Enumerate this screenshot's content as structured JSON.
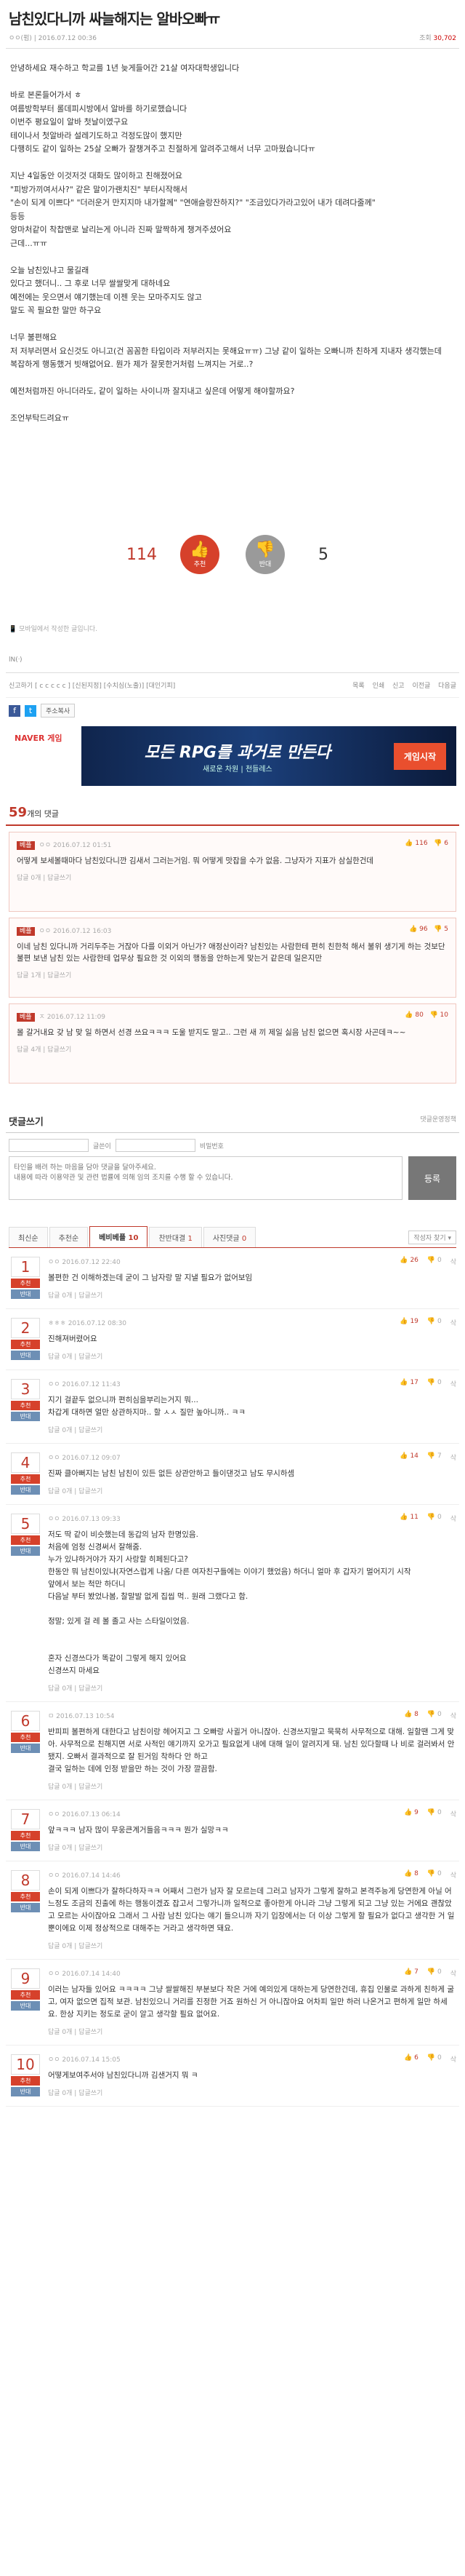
{
  "post": {
    "title": "남친있다니까 싸늘해지는 알바오빠ㅠ",
    "author": "ㅇㅇ(펌)",
    "date": "2016.07.12 00:36",
    "hits": "30,702",
    "body": "안녕하세요 재수하고 학교를 1년 늦게들어간 21살 여자대학생입니다\n\n바로 본론들어가서 ㅎ\n여름방학부터 롤데피시방에서 알바를 하기로했습니다\n이번주 평요일이 알바 첫날이였구요\n테이나서 첫알바라 설레기도하고 걱정도많이 했지만\n다행히도 같이 일하는 25살 오빠가 잘챙겨주고 친절하게 알려주고해서 너무 고마웠습니다ㅠ\n\n지난 4일동안 이것저것 대화도 많이하고 친해졌어요\n\"피방가끼여서사?\" 같은 말이가랜치진\" 부터시작해서\n\"손이 되게 이쁘다\" \"더러운거 만지지마 내가할께\" \"연애슬랑잔하지?\" \"조금있다가라고있어 내가 데려다줄께\"\n등등\n앙마처같이 착찹맨로 날리는게 아니라 진짜 말짝하게 챙겨주셨어요\n근데...ㅠㅠ\n\n오늘 남친있냐고 물길래\n있다고 했더니.. 그 후로 너무 쌀쌀맞게 대하네요\n예전에는 웃으면서 얘기했는데 이젠 웃는 모마주지도 않고\n말도 꼭 필요한 말만 하구요\n\n너무 불편해요\n저 저부러면서 요신것도 아니고(건 꼼꼼한 타입이라 저부러지는 못해요ㅠㅠ) 그냥 같이 일하는 오빠니까 친하게 지내자 생각했는데\n복잡하게 행동했거 빗해없어요. 뭔가 제가 잘못한거처럼 느껴지는 거로..?\n\n예전처럼까진 아니더라도, 같이 일하는 사이니까 잘지내고 싶은데 어떻게 해야할까요?\n\n조언부탁드려요ㅠ"
  },
  "votes": {
    "up": "114",
    "up_label": "추천",
    "down": "5",
    "down_label": "반대"
  },
  "note": "모바일에서 작성한 글입니다.",
  "tagline": "lN(ᐧ)",
  "report": {
    "label": "신고하기",
    "links": "[ c c c c c ] [신된지정] [수치심(노출)] [대인기피]",
    "right": [
      "목록",
      "인쇄",
      "신고",
      "이전글",
      "다음글"
    ]
  },
  "share": {
    "button": "주소복사"
  },
  "ad": {
    "brand": "NAVER 게임",
    "copy": "모든 RPG를 과거로 만든다",
    "sub": "새로운 차원 | 천들레스",
    "cta": "게임시작"
  },
  "comments_header": {
    "count": "59",
    "label": "개의 댓글"
  },
  "best": [
    {
      "badge": "베플",
      "meta": "ㅇㅇ  2016.07.12 01:51",
      "up": "116",
      "down": "6",
      "text": "어떻게 보세볼때마다 남친있다니깐 김새서 그러는거임. 뭐 어떻게 맛잡을 수가 없음. 그냥자가 지표가 삼실한건데",
      "foot": "답글 0개 | 답글쓰기"
    },
    {
      "badge": "베플",
      "meta": "ㅇㅇ  2016.07.12 16:03",
      "up": "96",
      "down": "5",
      "text": "이네 남친 있다니까 거리두주는 거잖아 다를 이외거 아닌가? 애정산이라? 남친있는 사람한테 편히 친한척 해서 불위 생기게 하는 것보단 불편 보낸 남친 있는 사람한테 업무상 필요한 것 이외의 행동을 안하는게 맞는거 같은데 일은지만",
      "foot": "답글 1개 | 답글쓰기"
    },
    {
      "badge": "베플",
      "meta": "ㅈ  2016.07.12 11:09",
      "up": "80",
      "down": "10",
      "text": "몰 갈거내요 갖 남 맞 일 하면서 선경 쓰요ㅋㅋㅋ 도울 받지도 말고.. 그런 새 끼 제일 싫음 남친 없으면 혹시장 사곤데ㅋ~~",
      "foot": "답글 4개 | 답글쓰기"
    }
  ],
  "write": {
    "title": "댓글쓰기",
    "policy": "댓글운영정책",
    "name_label": "글쓴이",
    "pw_label": "비밀번호",
    "placeholder": "타인을 배려 하는 마음을 담아 댓글을 달아주세요.\n내용에 따라 이용약관 및 관련 법률에 의해 임의 조치를 수행 할 수 있습니다.",
    "submit": "등록"
  },
  "tabs": [
    {
      "label": "최신순",
      "count": ""
    },
    {
      "label": "추천순",
      "count": ""
    },
    {
      "label": "베비베플",
      "count": "10"
    },
    {
      "label": "찬반대결",
      "count": "1"
    },
    {
      "label": "사진댓글",
      "count": "0"
    }
  ],
  "sort_label": "작성자 찾기 ▾",
  "ranked": [
    {
      "rank": "1",
      "meta": "ㅇㅇ  2016.07.12 22:40",
      "up": "26",
      "down": "0",
      "text": "볼편한 건 이해하겠는데 굳이 그 남자랑 말 지낼 필요가 없어보임",
      "foot": "답글 0개 | 답글쓰기"
    },
    {
      "rank": "2",
      "meta": "ㅎㅎㅎ  2016.07.12 08:30",
      "up": "19",
      "down": "0",
      "text": "진해져버렸어요",
      "foot": "답글 0개 | 답글쓰기"
    },
    {
      "rank": "3",
      "meta": "ㅇㅇ  2016.07.12 11:43",
      "up": "17",
      "down": "0",
      "text": "지기 걸끝두 없으니까 편히심을부리는거지 뭐...\n차갑게 대하면 얼만 상관하지마.. 할 ㅅㅅ 질만 높아니까.. ㅋㅋ",
      "foot": "답글 0개 | 답글쓰기"
    },
    {
      "rank": "4",
      "meta": "ㅇㅇ  2016.07.12 09:07",
      "up": "14",
      "down": "7",
      "text": "진짜 클아뻐지는 남친 남친이 있든 없든 상관안하고 들이댄것고 남도 무시하셈",
      "foot": "답글 0개 | 답글쓰기"
    },
    {
      "rank": "5",
      "meta": "ㅇㅇ  2016.07.13 09:33",
      "up": "11",
      "down": "0",
      "text": "저도 딱 같이 비슷했는데 동갑의 남자 한명있음.\n처음에 엄청 신경써서 잘해줌.\n누가 있냐하거야가 자기 사랑할 히페된다고?\n한동안 뭐 남친이있냐(자연스럽게 나옴/ 다른 여자친구들에는 이야기 했었음) 하더니 얼마 후 갑자기 멀어지기 시작\n앞에서 보는 척만 하더니\n다음날 부터 봤었나봄, 찰말발 없게 집씹 먹.. 원래 그랬다고 함.\n\n정말; 있게 걸 레 볼 졸고 사는 스타일이었음.\n\n\n혼자 신경쓰다가 똑같이 그렇게 해지 있어요\n신경쓰지 마세요",
      "foot": "답글 0개 | 답글쓰기"
    },
    {
      "rank": "6",
      "meta": "ㅁ  2016.07.13 10:54",
      "up": "8",
      "down": "0",
      "text": "반피피 볼편하게 대한다고 남친이랑 헤어지고 그 오빠랑 사귈거 아니잖아. 신경쓰지말고 묵묵히 사무적으로 대해. 일할땐 그게 맞아. 사무적으로 친해지면 서로 사적인 얘기까지 오가고 필요없게 내에 대해 일이 알려지게 돼. 남친 있다할때 나 비로 걸러봐서 안됐지. 오빠서 결과적으로 잘 된거임 착하다 안 하고\n결국 일하는 데에 인정 받을만 하는 것이 가장 깔끔함.",
      "foot": "답글 0개 | 답글쓰기"
    },
    {
      "rank": "7",
      "meta": "ㅇㅇ  2016.07.13 06:14",
      "up": "9",
      "down": "0",
      "text": "앞ㅋㅋㅋ 남자 많이 무웅큰계거들음ㅋㅋㅋ 뭔가 실망ㅋㅋ",
      "foot": "답글 0개 | 답글쓰기"
    },
    {
      "rank": "8",
      "meta": "ㅇㅇ  2016.07.14 14:46",
      "up": "8",
      "down": "0",
      "text": "손이 되게 이쁘다가 잘하다하자ㅋㅋ 어째서 그런가 남자 잘 모르는데 그러고 남자가 그렇게 잘하고 본격주능게 당연한게 아닐 어느정도 조금의 진출에 하는 행동이겠죠 잡고서 그렇가니까 일적으로 좋아한게 아니라 그냥 그렇게 되고 그냥 있는 거에요 괜찮았고 모르는 사이잖아요 그래서 그 사람 남친 있다는 얘기 들으니까 자기 입장에서는 더 이상 그렇게 할 필요가 없다고 생각한 거 일 뿐이에요 이제 정상적으로 대해주는 거라고 생각하면 돼요.",
      "foot": "답글 0개 | 답글쓰기"
    },
    {
      "rank": "9",
      "meta": "ㅇㅇ  2016.07.14 14:40",
      "up": "7",
      "down": "0",
      "text": "이러는 남자들 있어요 ㅋㅋㅋㅋ 그냥 쌀쌀해진 부분보다 작은 거에 예의있게 대하는게 당연한건데, 휴집 인물로 과하게 친하게 굴고, 여자 없으면 집적 보관. 남친있으니 거리를 진정한 거죠 원하신 거 아니잖아요 어차피 일만 하러 나온거고 편하게 일만 하세요. 한상 지키는 정도로 굳이 알고 생각할 필요 없어요.",
      "foot": "답글 0개 | 답글쓰기"
    },
    {
      "rank": "10",
      "meta": "ㅇㅇ  2016.07.14 15:05",
      "up": "6",
      "down": "0",
      "text": "어떻게보여주서야 남친있다니까 김샌거지 뭐 ㅋ",
      "foot": "답글 0개 | 답글쓰기"
    }
  ]
}
